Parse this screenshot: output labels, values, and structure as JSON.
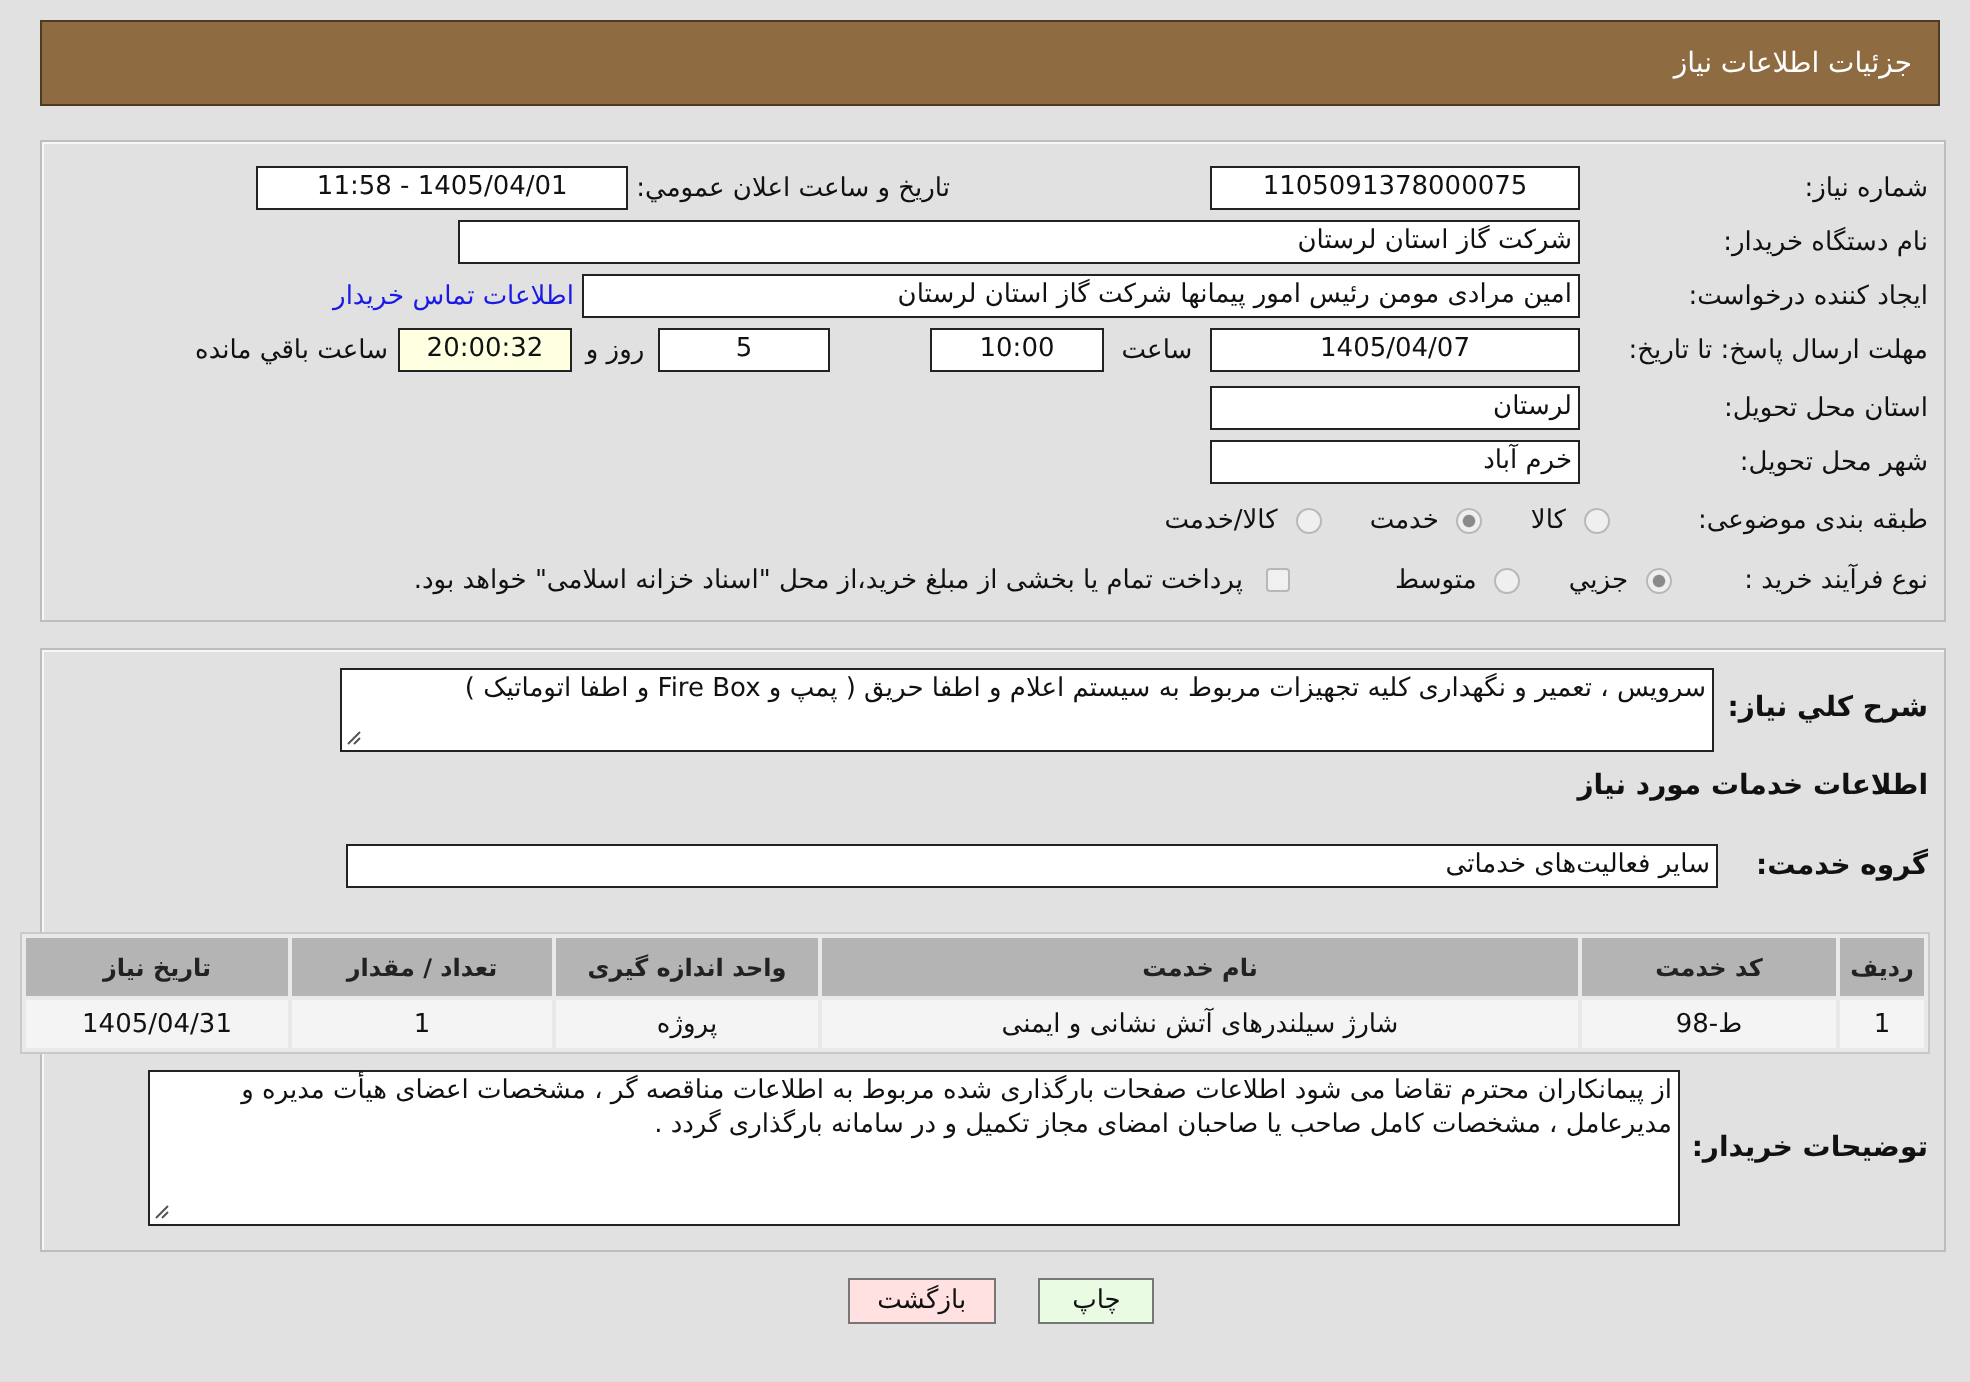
{
  "header": {
    "title": "جزئیات اطلاعات نیاز"
  },
  "details": {
    "need_number": {
      "label": "شماره نیاز:",
      "value": "1105091378000075"
    },
    "announce_datetime": {
      "label": "تاریخ و ساعت اعلان عمومي:",
      "value": "1405/04/01 - 11:58"
    },
    "buyer_org": {
      "label": "نام دستگاه خریدار:",
      "value": "شرکت گاز استان لرستان"
    },
    "requester": {
      "label": "ایجاد کننده درخواست:",
      "value": "امین مرادی مومن رئیس امور پیمانها شرکت گاز استان لرستان",
      "link": "اطلاعات تماس خریدار"
    },
    "deadline": {
      "label": "مهلت ارسال پاسخ: تا تاریخ:",
      "date": "1405/04/07",
      "time_label": "ساعت",
      "time": "10:00",
      "days": "5",
      "days_label": "روز و",
      "remaining": "20:00:32",
      "remaining_label": "ساعت باقي مانده"
    },
    "province": {
      "label": "استان محل تحویل:",
      "value": "لرستان"
    },
    "city": {
      "label": "شهر محل تحویل:",
      "value": "خرم آباد"
    },
    "category": {
      "label": "طبقه بندی موضوعی:",
      "options": [
        {
          "label": "کالا",
          "selected": false
        },
        {
          "label": "خدمت",
          "selected": true
        },
        {
          "label": "کالا/خدمت",
          "selected": false
        }
      ]
    },
    "purchase_type": {
      "label": "نوع فرآیند خرید :",
      "options": [
        {
          "label": "جزيي",
          "selected": true
        },
        {
          "label": "متوسط",
          "selected": false
        }
      ],
      "treasury": {
        "label": "پرداخت تمام یا بخشی از مبلغ خرید،از محل \"اسناد خزانه اسلامی\" خواهد بود.",
        "checked": false
      }
    }
  },
  "description": {
    "label": "شرح کلي نیاز:",
    "value": "سرویس ، تعمیر و نگهداری کلیه تجهیزات مربوط به سیستم اعلام و اطفا حریق ( پمپ و Fire Box و اطفا اتوماتیک )"
  },
  "services": {
    "title": "اطلاعات خدمات مورد نیاز",
    "group": {
      "label": "گروه خدمت:",
      "value": "سایر فعالیت‌های خدماتی"
    },
    "table": {
      "columns": [
        "ردیف",
        "کد خدمت",
        "نام خدمت",
        "واحد اندازه گیری",
        "تعداد / مقدار",
        "تاریخ نیاز"
      ],
      "rows": [
        [
          "1",
          "ط-98",
          "شارژ سیلندرهای آتش نشانی و ایمنی",
          "پروژه",
          "1",
          "1405/04/31"
        ]
      ]
    }
  },
  "buyer_notes": {
    "label": "توضیحات خریدار:",
    "value": "از پیمانکاران محترم تقاضا می شود اطلاعات صفحات بارگذاری شده مربوط به اطلاعات مناقصه گر ، مشخصات اعضای هیأت مدیره و مدیرعامل ، مشخصات کامل صاحب یا صاحبان امضای مجاز تکمیل و در سامانه بارگذاری گردد ."
  },
  "buttons": [
    {
      "label": "چاپ",
      "kind": "print"
    },
    {
      "label": "بازگشت",
      "kind": "back"
    }
  ]
}
